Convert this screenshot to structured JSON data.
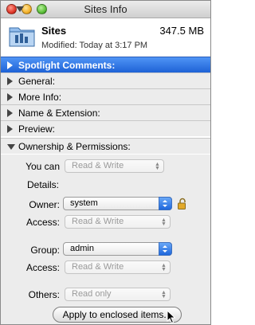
{
  "window": {
    "title": "Sites Info"
  },
  "header": {
    "name": "Sites",
    "size": "347.5 MB",
    "modified": "Modified: Today at 3:17 PM",
    "icon": "folder-icon"
  },
  "sections": [
    {
      "label": "Spotlight Comments:",
      "expanded": false,
      "selected": true
    },
    {
      "label": "General:",
      "expanded": false
    },
    {
      "label": "More Info:",
      "expanded": false
    },
    {
      "label": "Name & Extension:",
      "expanded": false
    },
    {
      "label": "Preview:",
      "expanded": false
    },
    {
      "label": "Ownership & Permissions:",
      "expanded": true
    }
  ],
  "ownership": {
    "you_can_label": "You can",
    "you_can_value": "Read & Write",
    "details_label": "Details:",
    "owner_label": "Owner:",
    "owner_value": "system",
    "owner_access_label": "Access:",
    "owner_access_value": "Read & Write",
    "group_label": "Group:",
    "group_value": "admin",
    "group_access_label": "Access:",
    "group_access_value": "Read & Write",
    "others_label": "Others:",
    "others_value": "Read only",
    "apply_button": "Apply to enclosed items..."
  },
  "colors": {
    "selected": "#1e62d6",
    "accent": "#3b82f0"
  }
}
